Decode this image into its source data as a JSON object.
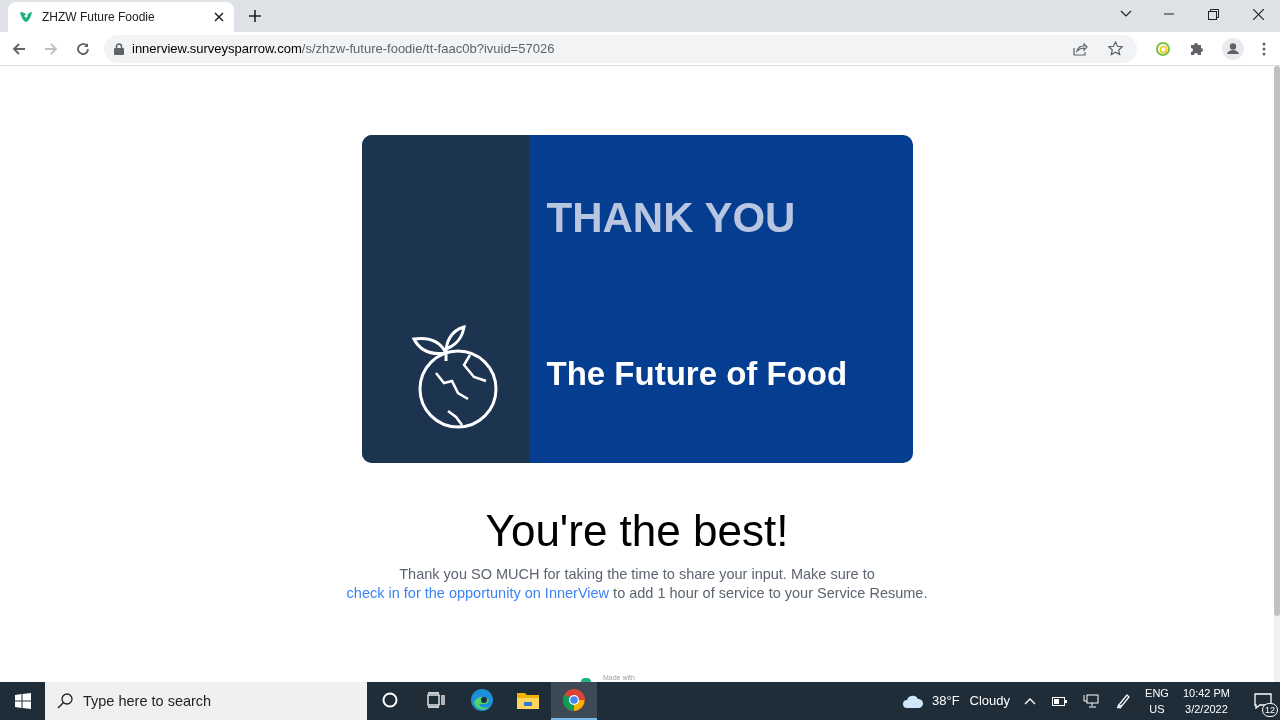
{
  "browser": {
    "tab": {
      "title": "ZHZW Future Foodie",
      "selected": true
    },
    "address": {
      "host": "innerview.surveysparrow.com",
      "path": "/s/zhzw-future-foodie/tt-faac0b?ivuid=57026"
    }
  },
  "page": {
    "banner": {
      "title": "THANK YOU",
      "subtitle": "The Future of Food"
    },
    "heading": "You're the best!",
    "message": {
      "before": "Thank you SO MUCH for taking the time to share your input. Make sure to ",
      "link": "check in for the opportunity on InnerView",
      "after": " to add 1 hour of service to your Service Resume."
    },
    "footer_badge": "Made with"
  },
  "taskbar": {
    "search_placeholder": "Type here to search",
    "apps": [
      {
        "kind": "cortana",
        "selected": false
      },
      {
        "kind": "taskview",
        "selected": false
      },
      {
        "kind": "edge",
        "selected": false
      },
      {
        "kind": "explorer",
        "selected": false
      },
      {
        "kind": "chrome",
        "selected": true
      }
    ],
    "weather": {
      "temperature": "38°F",
      "condition": "Cloudy"
    },
    "language": {
      "line1": "ENG",
      "line2": "US"
    },
    "clock": {
      "time": "10:42 PM",
      "date": "3/2/2022"
    },
    "notifications": "12"
  }
}
